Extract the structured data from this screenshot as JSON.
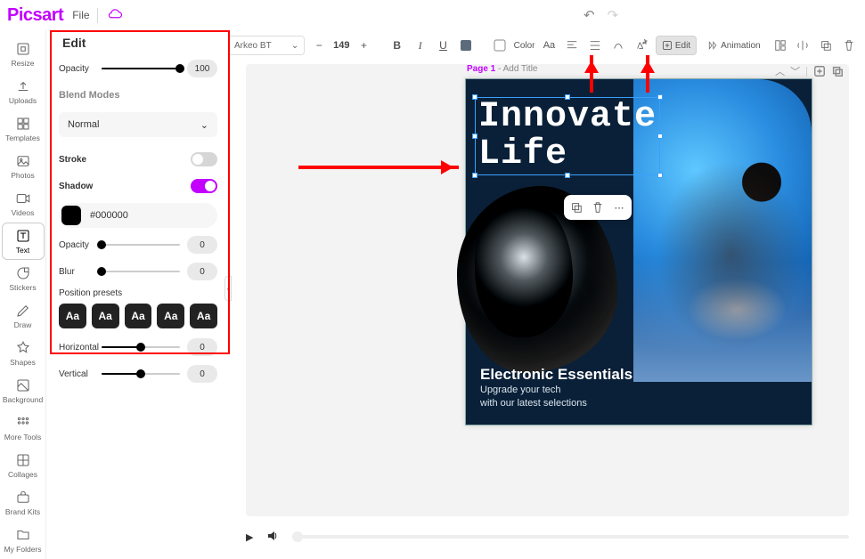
{
  "app": {
    "brand": "Picsart",
    "file_menu": "File"
  },
  "history": {
    "undo": "↶",
    "redo": "↷"
  },
  "nav": [
    {
      "id": "resize",
      "label": "Resize"
    },
    {
      "id": "uploads",
      "label": "Uploads"
    },
    {
      "id": "templates",
      "label": "Templates"
    },
    {
      "id": "photos",
      "label": "Photos"
    },
    {
      "id": "videos",
      "label": "Videos"
    },
    {
      "id": "text",
      "label": "Text",
      "active": true
    },
    {
      "id": "stickers",
      "label": "Stickers"
    },
    {
      "id": "draw",
      "label": "Draw"
    },
    {
      "id": "shapes",
      "label": "Shapes"
    },
    {
      "id": "background",
      "label": "Background"
    },
    {
      "id": "moretools",
      "label": "More Tools"
    },
    {
      "id": "collages",
      "label": "Collages"
    },
    {
      "id": "brandkits",
      "label": "Brand Kits"
    },
    {
      "id": "myfolders",
      "label": "My Folders"
    }
  ],
  "panel": {
    "title": "Edit",
    "opacity": {
      "label": "Opacity",
      "value": "100",
      "pct": 100
    },
    "blend": {
      "heading": "Blend Modes",
      "value": "Normal"
    },
    "stroke": {
      "label": "Stroke",
      "on": false
    },
    "shadow": {
      "label": "Shadow",
      "on": true,
      "color": "#000000",
      "opacity": {
        "label": "Opacity",
        "value": "0",
        "pct": 0
      },
      "blur": {
        "label": "Blur",
        "value": "0",
        "pct": 0
      },
      "presets_label": "Position presets",
      "presets": [
        "Aa",
        "Aa",
        "Aa",
        "Aa",
        "Aa"
      ],
      "horizontal": {
        "label": "Horizontal",
        "value": "0",
        "pct": 50
      },
      "vertical": {
        "label": "Vertical",
        "value": "0",
        "pct": 50
      }
    }
  },
  "toolbar": {
    "font": "Arkeo BT",
    "size": "149",
    "minus": "−",
    "plus": "+",
    "bold": "B",
    "italic": "I",
    "underline": "U",
    "color_label": "Color",
    "caseAa": "Aa",
    "edit_label": "Edit",
    "animation_label": "Animation"
  },
  "page": {
    "label": "Page 1",
    "add": " - Add Title"
  },
  "art": {
    "headline_l1": "Innovate",
    "headline_l2": "Life",
    "sub": "Electronic Essentials",
    "copy_l1": "Upgrade your tech",
    "copy_l2": "with our latest selections"
  }
}
